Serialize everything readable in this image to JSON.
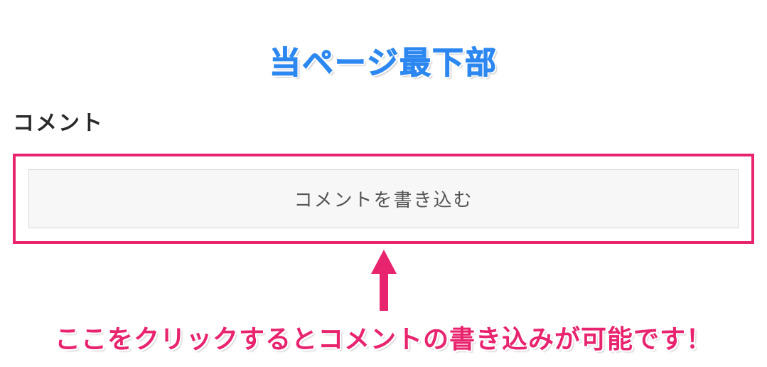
{
  "banner": {
    "title": "当ページ最下部"
  },
  "section": {
    "heading": "コメント"
  },
  "comment": {
    "button_label": "コメントを書き込む"
  },
  "instruction": {
    "text": "ここをクリックするとコメントの書き込みが可能です！"
  },
  "colors": {
    "banner_blue": "#2c88f0",
    "accent_pink": "#e8246f",
    "button_bg": "#f7f7f7",
    "button_border": "#d9d9d9",
    "text_dark": "#2a2a2a"
  }
}
